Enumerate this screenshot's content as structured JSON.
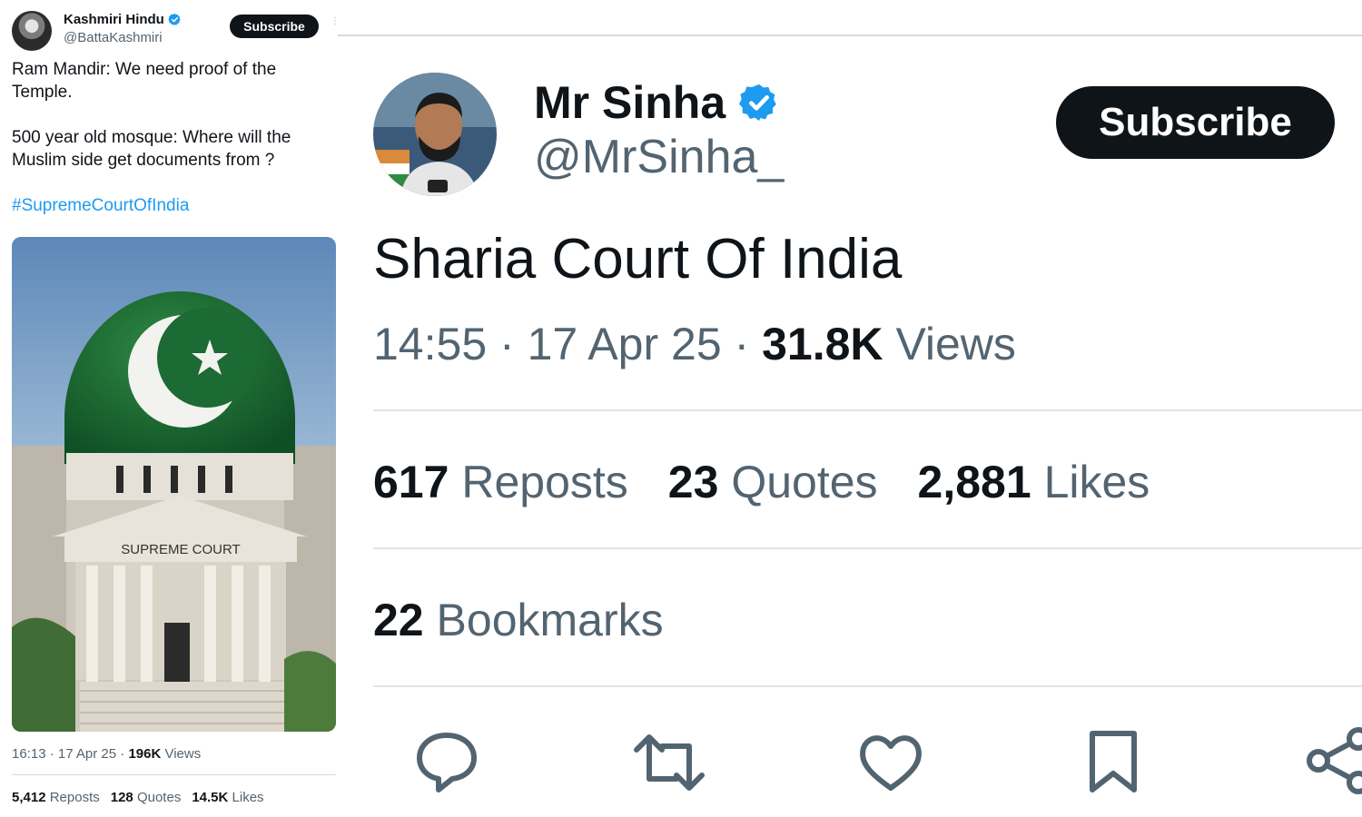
{
  "left_tweet": {
    "author_name": "Kashmiri Hindu",
    "author_handle": "@BattaKashmiri",
    "subscribe_label": "Subscribe",
    "text_line1": "Ram Mandir: We need proof of the Temple.",
    "text_line2": "500 year old mosque: Where will the Muslim side get documents from ?",
    "hashtag": "#SupremeCourtOfIndia",
    "image_caption": "SUPREME COURT",
    "time": "16:13",
    "date": "17 Apr 25",
    "views_count": "196K",
    "views_label": "Views",
    "reposts_count": "5,412",
    "reposts_label": "Reposts",
    "quotes_count": "128",
    "quotes_label": "Quotes",
    "likes_count": "14.5K",
    "likes_label": "Likes"
  },
  "right_tweet": {
    "author_name": "Mr Sinha",
    "author_handle": "@MrSinha_",
    "subscribe_label": "Subscribe",
    "text": "Sharia Court Of India",
    "time": "14:55",
    "date": "17 Apr 25",
    "views_count": "31.8K",
    "views_label": "Views",
    "reposts_count": "617",
    "reposts_label": "Reposts",
    "quotes_count": "23",
    "quotes_label": "Quotes",
    "likes_count": "2,881",
    "likes_label": "Likes",
    "bookmarks_count": "22",
    "bookmarks_label": "Bookmarks",
    "actions": [
      "reply-icon",
      "repost-icon",
      "like-icon",
      "bookmark-icon",
      "share-icon"
    ]
  },
  "colors": {
    "text_primary": "#0f1419",
    "text_secondary": "#536471",
    "link": "#1d9bf0",
    "verified": "#1d9bf0",
    "button_bg": "#0f1419"
  }
}
